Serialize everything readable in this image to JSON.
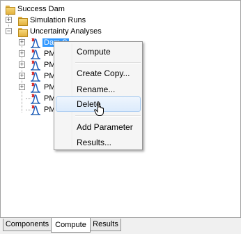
{
  "tree": {
    "root": {
      "label": "Success Dam",
      "icon": "folder-icon"
    },
    "simulation_runs": {
      "label": "Simulation Runs",
      "expander": "+",
      "icon": "folder-icon"
    },
    "uncertainty_analyses": {
      "label": "Uncertainty Analyses",
      "expander": "−",
      "icon": "folder-icon"
    },
    "analyses": [
      {
        "label": "Dam S",
        "selected": true,
        "expander": "+",
        "icon": "distribution-icon"
      },
      {
        "label": "PM",
        "selected": false,
        "expander": "+",
        "icon": "distribution-icon"
      },
      {
        "label": "PM",
        "selected": false,
        "expander": "+",
        "icon": "distribution-icon"
      },
      {
        "label": "PM",
        "selected": false,
        "expander": "+",
        "icon": "distribution-icon"
      },
      {
        "label": "PM",
        "selected": false,
        "expander": "+",
        "icon": "distribution-icon"
      },
      {
        "label": "PM",
        "selected": false,
        "expander": "",
        "icon": "distribution-icon"
      },
      {
        "label": "PM",
        "selected": false,
        "expander": "",
        "icon": "distribution-icon"
      }
    ]
  },
  "context_menu": {
    "items": [
      {
        "label": "Compute"
      },
      {
        "label": "Create Copy..."
      },
      {
        "label": "Rename..."
      },
      {
        "label": "Delete",
        "hovered": true
      },
      {
        "label": "Add Parameter"
      },
      {
        "label": "Results..."
      }
    ]
  },
  "tabs": [
    {
      "label": "Components",
      "active": false
    },
    {
      "label": "Compute",
      "active": true
    },
    {
      "label": "Results",
      "active": false
    }
  ],
  "colors": {
    "selection": "#3399ff",
    "menu_hover_border": "#a8cbf1",
    "folder": "#e3b23e"
  }
}
